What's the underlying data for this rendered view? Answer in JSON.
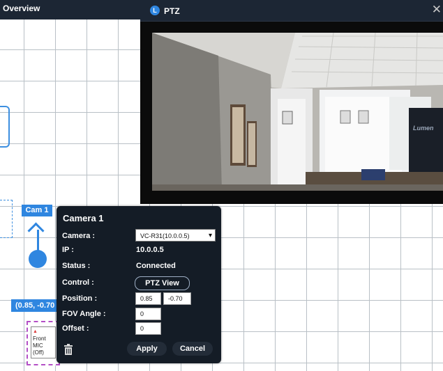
{
  "overview": {
    "title": "Overview"
  },
  "ptz_window": {
    "title": "PTZ",
    "logo_letter": "L",
    "close_glyph": "✕",
    "watermark": "Lumen"
  },
  "map": {
    "cam_tag": "Cam 1",
    "position_tag": "(0.85, -0.70",
    "mic": {
      "arrow": "▲",
      "line1": "Front",
      "line2": "MIC",
      "line3": "(Off)"
    }
  },
  "camera_panel": {
    "title": "Camera 1",
    "camera_label": "Camera :",
    "camera_value": "VC-R31(10.0.0.5)",
    "ip_label": "IP :",
    "ip_value": "10.0.0.5",
    "status_label": "Status :",
    "status_value": "Connected",
    "control_label": "Control :",
    "ptz_view_label": "PTZ View",
    "position_label": "Position :",
    "position_x": "0.85",
    "position_y": "-0.70",
    "fov_label": "FOV Angle :",
    "fov_value": "0",
    "offset_label": "Offset :",
    "offset_value": "0",
    "apply_label": "Apply",
    "cancel_label": "Cancel"
  },
  "colors": {
    "accent": "#2f86e0",
    "panel_bg": "#141c26",
    "header_bg": "#1c2634",
    "mic_border": "#b44fc6"
  },
  "icons": {
    "trash": "trash-icon",
    "chevron": "chevron-down-icon",
    "close": "close-icon"
  }
}
